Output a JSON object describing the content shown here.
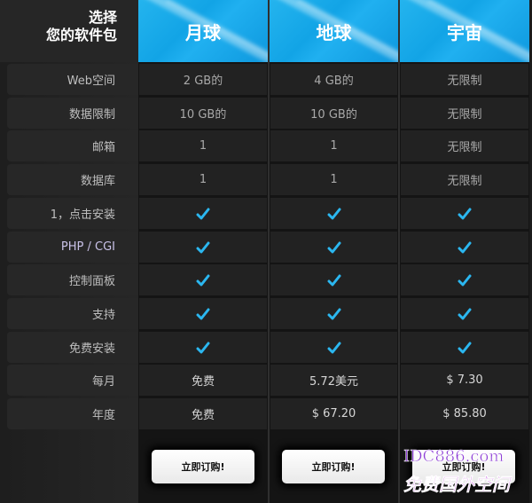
{
  "header": {
    "title_line1": "选择",
    "title_line2": "您的软件包",
    "plans": [
      "月球",
      "地球",
      "宇宙"
    ]
  },
  "rows": [
    {
      "label": "Web空间",
      "values": [
        "2 GB的",
        "4 GB的",
        "无限制"
      ]
    },
    {
      "label": "数据限制",
      "values": [
        "10 GB的",
        "10 GB的",
        "无限制"
      ]
    },
    {
      "label": "邮箱",
      "values": [
        "1",
        "1",
        "无限制"
      ]
    },
    {
      "label": "数据库",
      "values": [
        "1",
        "1",
        "无限制"
      ]
    },
    {
      "label": "1，点击安装",
      "values": [
        "✓",
        "✓",
        "✓"
      ]
    },
    {
      "label": "PHP / CGI",
      "values": [
        "✓",
        "✓",
        "✓"
      ]
    },
    {
      "label": "控制面板",
      "values": [
        "✓",
        "✓",
        "✓"
      ]
    },
    {
      "label": "支持",
      "values": [
        "✓",
        "✓",
        "✓"
      ]
    },
    {
      "label": "免费安装",
      "values": [
        "✓",
        "✓",
        "✓"
      ]
    },
    {
      "label": "每月",
      "values": [
        "免费",
        "5.72美元",
        "$ 7.30"
      ]
    },
    {
      "label": "年度",
      "values": [
        "免费",
        "$ 67.20",
        "$ 85.80"
      ]
    }
  ],
  "order_button_label": "立即订购!",
  "watermark": {
    "line1": "IDC886.com",
    "line2": "免费国外空间"
  },
  "colors": {
    "accent": "#17a9ea",
    "check": "#2bb7f0"
  }
}
